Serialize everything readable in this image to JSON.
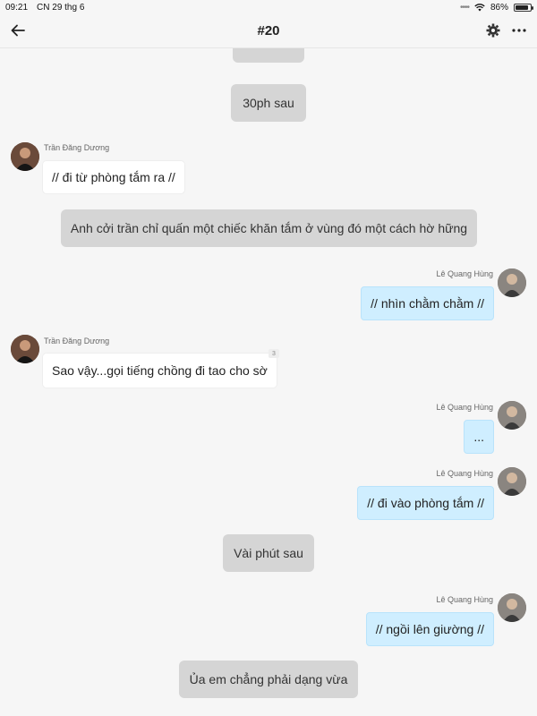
{
  "status": {
    "time": "09:21",
    "date": "CN 29 thg 6",
    "battery": "86%",
    "battery_level": 0.86
  },
  "header": {
    "title": "#20",
    "icons": [
      "back-arrow-icon",
      "gear-icon",
      "more-icon"
    ]
  },
  "messages": {
    "narr_top": "",
    "narr_1": "30ph sau",
    "m1_sender": "Trần Đăng Dương",
    "m1_text": "// đi từ phòng tắm ra //",
    "narr_2": "Anh cởi trần chỉ quấn một chiếc khăn tắm ở vùng đó một cách hờ hững",
    "m2_sender": "Lê Quang Hùng",
    "m2_text": "// nhìn chằm chằm //",
    "m3_sender": "Trần Đăng Dương",
    "m3_text": "Sao vậy...gọi tiếng chồng đi tao cho sờ",
    "m3_badge": "3",
    "m4_sender": "Lê Quang Hùng",
    "m4_text": "...",
    "m5_sender": "Lê Quang Hùng",
    "m5_text": "// đi vào phòng tắm //",
    "narr_3": "Vài phút sau",
    "m6_sender": "Lê Quang Hùng",
    "m6_text": "// ngồi lên giường //",
    "narr_4": "Ủa em chẳng phải dạng vừa"
  },
  "colors": {
    "narration_bg": "#d5d5d5",
    "outgoing_bg": "#cfeeff",
    "incoming_bg": "#ffffff"
  }
}
